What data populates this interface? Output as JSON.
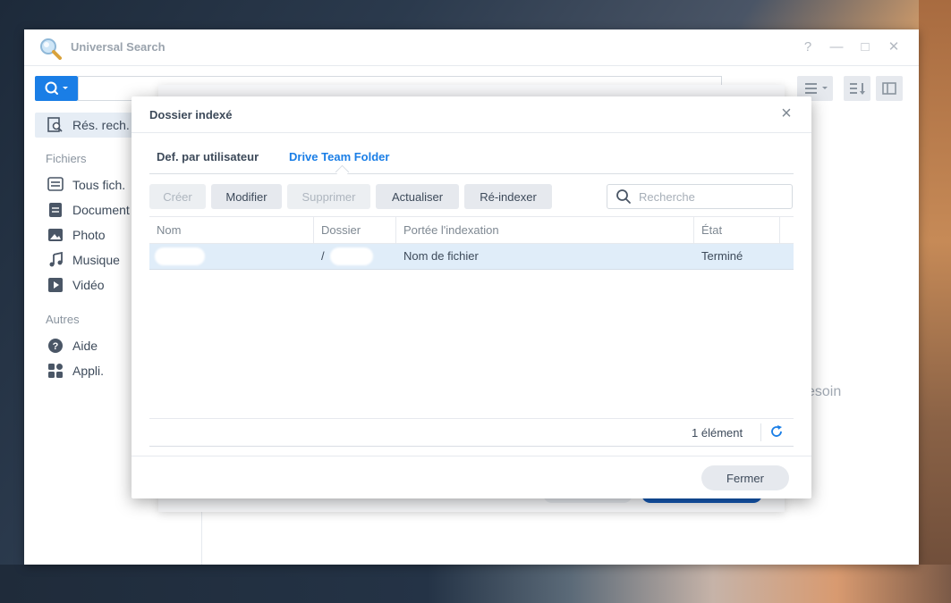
{
  "window": {
    "title": "Universal Search",
    "controls": {
      "help": "?",
      "minimize": "—",
      "maximize": "□",
      "close": "✕"
    }
  },
  "sidebar": {
    "active_item": "Rés. rech.",
    "section_files": "Fichiers",
    "files_items": [
      "Tous fich.",
      "Document",
      "Photo",
      "Musique",
      "Vidéo"
    ],
    "section_other": "Autres",
    "other_items": [
      "Aide",
      "Appli."
    ]
  },
  "background": {
    "hint_fragment": "esoin"
  },
  "dialog": {
    "title": "Dossier indexé",
    "tabs": [
      {
        "label": "Def. par utilisateur",
        "active": false
      },
      {
        "label": "Drive Team Folder",
        "active": true
      }
    ],
    "toolbar": {
      "create": "Créer",
      "modify": "Modifier",
      "delete": "Supprimer",
      "refresh": "Actualiser",
      "reindex": "Ré-indexer"
    },
    "search": {
      "placeholder": "Recherche"
    },
    "table": {
      "columns": [
        "Nom",
        "Dossier",
        "Portée l'indexation",
        "État"
      ],
      "rows": [
        {
          "name": "",
          "folder": "/",
          "scope": "Nom de fichier",
          "state": "Terminé"
        }
      ]
    },
    "footer_count": "1 élément",
    "close_button": "Fermer"
  },
  "colors": {
    "accent": "#1a7ee6",
    "selected_row": "#e0edf9",
    "text": "#3d4a5a",
    "muted": "#7e8892"
  }
}
